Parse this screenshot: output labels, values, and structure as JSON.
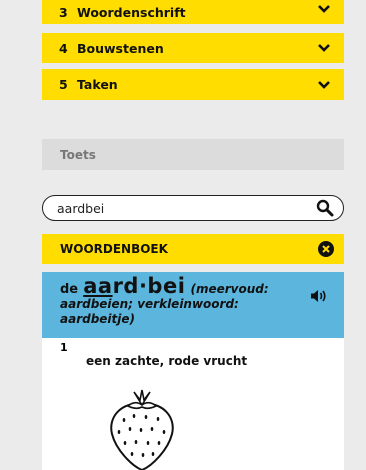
{
  "menu": {
    "items": [
      {
        "num": "3",
        "label": "Woordenschrift"
      },
      {
        "num": "4",
        "label": "Bouwstenen"
      },
      {
        "num": "5",
        "label": "Taken"
      }
    ]
  },
  "toets": {
    "label": "Toets"
  },
  "search": {
    "value": "aardbei"
  },
  "woordenboek": {
    "title": "WOORDENBOEK"
  },
  "entry": {
    "article": "de",
    "word_underlined": "aa",
    "word_rest": "rd·bei",
    "grammar": "(meervoud: aardbeien; verkleinwoord: aardbeitje)"
  },
  "sense": {
    "number": "1",
    "definition": "een zachte, rode vrucht"
  },
  "icons": {
    "chevron": "chevron-down-icon",
    "search": "search-icon",
    "close": "close-icon",
    "speaker": "speaker-icon"
  },
  "colors": {
    "accent_yellow": "#ffdd00",
    "entry_blue": "#5bb5dd"
  }
}
